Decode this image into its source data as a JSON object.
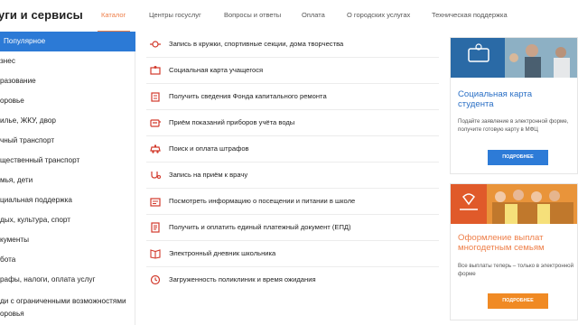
{
  "header": {
    "title": "уги и сервисы",
    "nav": [
      {
        "label": "Каталог",
        "active": true
      },
      {
        "label": "Центры госуслуг",
        "active": false
      },
      {
        "label": "Вопросы и ответы",
        "active": false
      },
      {
        "label": "Оплата",
        "active": false
      },
      {
        "label": "О городских услугах",
        "active": false
      },
      {
        "label": "Техническая поддержка",
        "active": false
      }
    ]
  },
  "sidebar": {
    "items": [
      {
        "label": "Популярное",
        "active": true
      },
      {
        "label": "знес"
      },
      {
        "label": "разование"
      },
      {
        "label": "оровье"
      },
      {
        "label": "илье, ЖКУ, двор"
      },
      {
        "label": "чный транспорт"
      },
      {
        "label": "щественный транспорт"
      },
      {
        "label": "мья, дети"
      },
      {
        "label": "циальная поддержка"
      },
      {
        "label": "дых, культура, спорт"
      },
      {
        "label": "кументы"
      },
      {
        "label": "бота"
      },
      {
        "label": "рафы, налоги, оплата услуг"
      },
      {
        "label": "ди с ограниченными возможностями"
      },
      {
        "label": "оровья"
      }
    ]
  },
  "services": [
    {
      "label": "Запись в кружки, спортивные секции, дома творчества",
      "icon": "ball-icon"
    },
    {
      "label": "Социальная карта учащегося",
      "icon": "card-icon"
    },
    {
      "label": "Получить сведения Фонда капитального ремонта",
      "icon": "building-icon"
    },
    {
      "label": "Приём показаний приборов учёта воды",
      "icon": "water-meter-icon"
    },
    {
      "label": "Поиск и оплата штрафов",
      "icon": "police-car-icon"
    },
    {
      "label": "Запись на приём к врачу",
      "icon": "stethoscope-icon"
    },
    {
      "label": "Посмотреть информацию о посещении и питании в школе",
      "icon": "school-icon"
    },
    {
      "label": "Получить и оплатить единый платежный документ (ЕПД)",
      "icon": "document-icon"
    },
    {
      "label": "Электронный дневник школьника",
      "icon": "diary-icon"
    },
    {
      "label": "Загруженность поликлиник и время ожидания",
      "icon": "clock-icon"
    }
  ],
  "cards": [
    {
      "title_line1": "Социальная карта",
      "title_line2": "студента",
      "desc_line1": "Подайте заявление в электронной форме,",
      "desc_line2": "получите готовую карту в МФЦ",
      "button": "ПОДРОБНЕЕ",
      "color": "#2d7bd7"
    },
    {
      "title_line1": "Оформление выплат",
      "title_line2": "многодетным семьям",
      "desc_line1": "Все выплаты теперь – только в электронной",
      "desc_line2": "форме",
      "button": "ПОДРОБНЕЕ",
      "color": "#f08a24"
    }
  ],
  "colors": {
    "accent_orange": "#ee7e48",
    "active_blue": "#2c7ad6",
    "icon_red": "#d23a2c"
  }
}
